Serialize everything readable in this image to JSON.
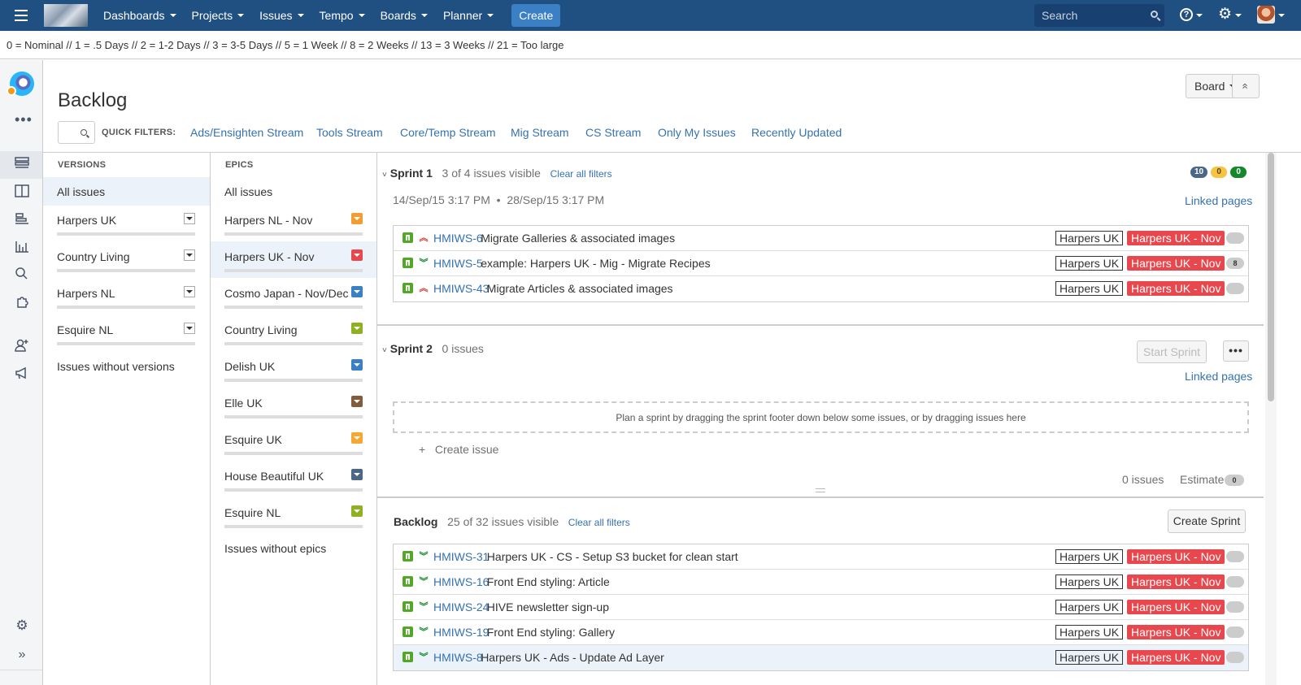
{
  "topnav": {
    "menu": [
      "Dashboards",
      "Projects",
      "Issues",
      "Tempo",
      "Boards",
      "Planner"
    ],
    "create_label": "Create",
    "search_placeholder": "Search",
    "help_glyph": "?",
    "gear_glyph": "⚙"
  },
  "legend": "0 = Nominal // 1 = .5 Days // 2 = 1-2 Days // 3 = 3-5 Days // 5 = 1 Week // 8 = 2 Weeks // 13 = 3 Weeks // 21 = Too large",
  "sidebar": {
    "more": "•••",
    "icons": [
      "backlog-icon",
      "board-icon",
      "releases-icon",
      "reports-icon",
      "issues-icon",
      "addons-icon",
      "add-user-icon",
      "feedback-icon"
    ],
    "settings_glyph": "⚙",
    "expand_glyph": "»"
  },
  "page": {
    "title": "Backlog",
    "board_label": "Board",
    "collapse_glyph": "«"
  },
  "quick_filters": {
    "label": "QUICK FILTERS:",
    "items": [
      "Ads/Ensighten Stream",
      "Tools Stream",
      "Core/Temp Stream",
      "Mig Stream",
      "CS Stream",
      "Only My Issues",
      "Recently Updated"
    ]
  },
  "versions": {
    "header": "VERSIONS",
    "all": "All issues",
    "items": [
      "Harpers UK",
      "Country Living",
      "Harpers NL",
      "Esquire NL"
    ],
    "without": "Issues without versions"
  },
  "epics": {
    "header": "EPICS",
    "all": "All issues",
    "items": [
      {
        "label": "Harpers NL - Nov",
        "color": "#f39c31"
      },
      {
        "label": "Harpers UK - Nov",
        "color": "#e8484d"
      },
      {
        "label": "Cosmo Japan - Nov/Dec",
        "color": "#3b7fc4"
      },
      {
        "label": "Country Living",
        "color": "#8eb021"
      },
      {
        "label": "Delish UK",
        "color": "#3b7fc4"
      },
      {
        "label": "Elle UK",
        "color": "#815b3a"
      },
      {
        "label": "Esquire UK",
        "color": "#f6a633"
      },
      {
        "label": "House Beautiful UK",
        "color": "#4a6785"
      },
      {
        "label": "Esquire NL",
        "color": "#8eb021"
      }
    ],
    "without": "Issues without epics"
  },
  "sprint1": {
    "name": "Sprint 1",
    "visible": "3 of 4 issues visible",
    "clear": "Clear all filters",
    "dates": "14/Sep/15 3:17 PM  •  28/Sep/15 3:17 PM",
    "linked": "Linked pages",
    "badges": [
      {
        "value": "10",
        "color": "#4a6785"
      },
      {
        "value": "0",
        "color": "#f6c342"
      },
      {
        "value": "0",
        "color": "#14892c"
      }
    ],
    "issues": [
      {
        "key": "HMIWS-6",
        "title": "Migrate Galleries & associated images",
        "priority": "up",
        "version": "Harpers UK",
        "epic": "Harpers UK - Nov",
        "estimate": ""
      },
      {
        "key": "HMIWS-5",
        "title": "example: Harpers UK - Mig - Migrate Recipes",
        "priority": "down",
        "version": "Harpers UK",
        "epic": "Harpers UK - Nov",
        "estimate": "8"
      },
      {
        "key": "HMIWS-43",
        "title": "Migrate Articles & associated images",
        "priority": "up",
        "version": "Harpers UK",
        "epic": "Harpers UK - Nov",
        "estimate": ""
      }
    ]
  },
  "sprint2": {
    "name": "Sprint 2",
    "count": "0 issues",
    "start": "Start Sprint",
    "more": "•••",
    "linked": "Linked pages",
    "dropzone": "Plan a sprint by dragging the sprint footer down below some issues, or by dragging issues here",
    "create_issue": "Create issue",
    "footer_count": "0 issues",
    "estimate_label": "Estimate",
    "estimate_value": "0"
  },
  "backlog": {
    "name": "Backlog",
    "visible": "25 of 32 issues visible",
    "clear": "Clear all filters",
    "create_sprint": "Create Sprint",
    "issues": [
      {
        "key": "HMIWS-31",
        "title": "Harpers UK - CS - Setup S3 bucket for clean start",
        "priority": "down",
        "version": "Harpers UK",
        "epic": "Harpers UK - Nov",
        "estimate": ""
      },
      {
        "key": "HMIWS-16",
        "title": "Front End styling: Article",
        "priority": "down",
        "version": "Harpers UK",
        "epic": "Harpers UK - Nov",
        "estimate": ""
      },
      {
        "key": "HMIWS-24",
        "title": "HIVE newsletter sign-up",
        "priority": "down",
        "version": "Harpers UK",
        "epic": "Harpers UK - Nov",
        "estimate": ""
      },
      {
        "key": "HMIWS-19",
        "title": "Front End styling: Gallery",
        "priority": "down",
        "version": "Harpers UK",
        "epic": "Harpers UK - Nov",
        "estimate": ""
      },
      {
        "key": "HMIWS-8",
        "title": "Harpers UK - Ads - Update Ad Layer",
        "priority": "down",
        "version": "Harpers UK",
        "epic": "Harpers UK - Nov",
        "estimate": ""
      }
    ]
  },
  "colors": {
    "nav": "#205081",
    "link": "#3572b0",
    "epic": "#e8484d",
    "story": "#51a825",
    "prio_up": "#d04437",
    "prio_down": "#14892c"
  }
}
